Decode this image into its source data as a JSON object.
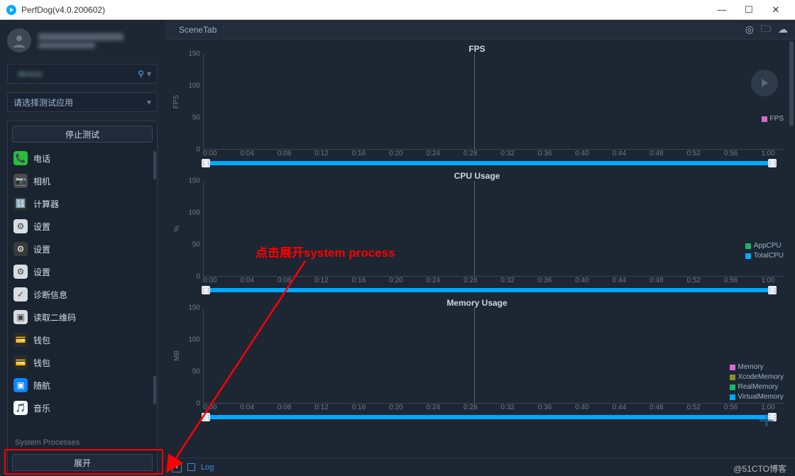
{
  "window": {
    "title": "PerfDog(v4.0.200602)"
  },
  "sidebar": {
    "device_platform_icon": "apple",
    "select_app_placeholder": "请选择测试应用",
    "stop_test_label": "停止测试",
    "apps": [
      {
        "label": "电话",
        "color": "#25c03c",
        "glyph": "📞"
      },
      {
        "label": "相机",
        "color": "#4a4a4a",
        "glyph": "📷"
      },
      {
        "label": "计算器",
        "color": "#2b2b2b",
        "glyph": "🔢"
      },
      {
        "label": "设置",
        "color": "#d9dce0",
        "glyph": "⚙"
      },
      {
        "label": "设置",
        "color": "#3a3a3a",
        "glyph": "⚙"
      },
      {
        "label": "设置",
        "color": "#d9dce0",
        "glyph": "⚙"
      },
      {
        "label": "诊断信息",
        "color": "#d9dce0",
        "glyph": "✓"
      },
      {
        "label": "读取二维码",
        "color": "#d9dce0",
        "glyph": "▣"
      },
      {
        "label": "钱包",
        "color": "#2b2b2b",
        "glyph": "💳"
      },
      {
        "label": "钱包",
        "color": "#2b2b2b",
        "glyph": "💳"
      },
      {
        "label": "随航",
        "color": "#0a84ff",
        "glyph": "▣"
      },
      {
        "label": "音乐",
        "color": "#ffffff",
        "glyph": "🎵"
      }
    ],
    "system_processes_label": "System Processes",
    "expand_label": "展开"
  },
  "tabbar": {
    "scene_tab": "SceneTab"
  },
  "annotation": {
    "text": "点击展开system process"
  },
  "bottom": {
    "log_label": "Log"
  },
  "watermark": "@51CTO博客",
  "chart_data": [
    {
      "type": "line",
      "title": "FPS",
      "ylabel": "FPS",
      "ylim": [
        0,
        150
      ],
      "yticks": [
        0,
        50,
        100,
        150
      ],
      "xticks": [
        "0:00",
        "0:04",
        "0:08",
        "0:12",
        "0:16",
        "0:20",
        "0:24",
        "0:28",
        "0:32",
        "0:36",
        "0:40",
        "0:44",
        "0:48",
        "0:52",
        "0:56",
        "1:00"
      ],
      "series": [
        {
          "name": "FPS",
          "color": "#d36bd3",
          "values": []
        }
      ],
      "cursor_x": "0:28",
      "slider_range": [
        "0:00",
        "1:00"
      ]
    },
    {
      "type": "line",
      "title": "CPU Usage",
      "ylabel": "%",
      "ylim": [
        0,
        150
      ],
      "yticks": [
        0,
        50,
        100,
        150
      ],
      "xticks": [
        "0:00",
        "0:04",
        "0:08",
        "0:12",
        "0:16",
        "0:20",
        "0:24",
        "0:28",
        "0:32",
        "0:36",
        "0:40",
        "0:44",
        "0:48",
        "0:52",
        "0:56",
        "1:00"
      ],
      "series": [
        {
          "name": "AppCPU",
          "color": "#1cb46a",
          "values": []
        },
        {
          "name": "TotalCPU",
          "color": "#00aaff",
          "values": []
        }
      ],
      "cursor_x": "0:28",
      "slider_range": [
        "0:00",
        "1:00"
      ]
    },
    {
      "type": "line",
      "title": "Memory Usage",
      "ylabel": "MB",
      "ylim": [
        0,
        150
      ],
      "yticks": [
        0,
        50,
        100,
        150
      ],
      "xticks": [
        "0:00",
        "0:04",
        "0:08",
        "0:12",
        "0:16",
        "0:20",
        "0:24",
        "0:28",
        "0:32",
        "0:36",
        "0:40",
        "0:44",
        "0:48",
        "0:52",
        "0:56",
        "1:00"
      ],
      "series": [
        {
          "name": "Memory",
          "color": "#d36bd3",
          "values": []
        },
        {
          "name": "XcodeMemory",
          "color": "#8a8f2a",
          "values": []
        },
        {
          "name": "RealMemory",
          "color": "#1cb46a",
          "values": []
        },
        {
          "name": "VirtualMemory",
          "color": "#00aaff",
          "values": []
        }
      ],
      "cursor_x": "0:28",
      "slider_range": [
        "0:00",
        "1:00"
      ]
    }
  ]
}
